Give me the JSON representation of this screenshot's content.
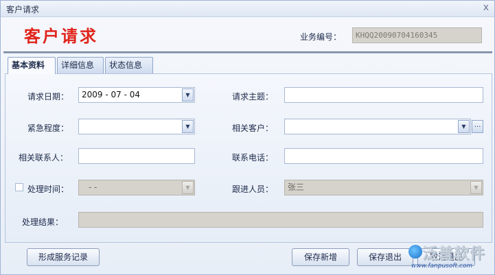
{
  "window": {
    "title": "客户请求",
    "close_glyph": "x"
  },
  "header": {
    "title": "客户请求",
    "business_no_label": "业务编号：",
    "business_no_value": "KHQQ20090704160345"
  },
  "tabs": [
    {
      "label": "基本资料",
      "active": true
    },
    {
      "label": "详细信息",
      "active": false
    },
    {
      "label": "状态信息",
      "active": false
    }
  ],
  "form": {
    "request_date_label": "请求日期：",
    "request_date_value": "2009 - 07 - 04",
    "request_subject_label": "请求主题：",
    "request_subject_value": "",
    "urgency_label": "紧急程度：",
    "urgency_value": "",
    "related_customer_label": "相关客户：",
    "related_customer_value": "",
    "related_contact_label": "相关联系人：",
    "related_contact_value": "",
    "phone_label": "联系电话：",
    "phone_value": "",
    "handle_time_label": "处理时间：",
    "handle_time_value": "-    -",
    "handle_time_checked": false,
    "follower_label": "跟进人员：",
    "follower_value": "张三",
    "result_label": "处理结果：",
    "result_value": ""
  },
  "icons": {
    "dropdown": "▼",
    "ellipsis": "..."
  },
  "footer": {
    "create_record_label": "形成服务记录",
    "save_new_label": "保存新增",
    "save_exit_label": "保存退出",
    "cancel_exit_label": "取消退出"
  },
  "watermark": {
    "brand": "泛普软件",
    "url": "www.fanpusoft.com"
  },
  "colors": {
    "title_red": "#e0241b",
    "disabled_field": "#d6d3cd",
    "field_border": "#a7b8d2"
  }
}
